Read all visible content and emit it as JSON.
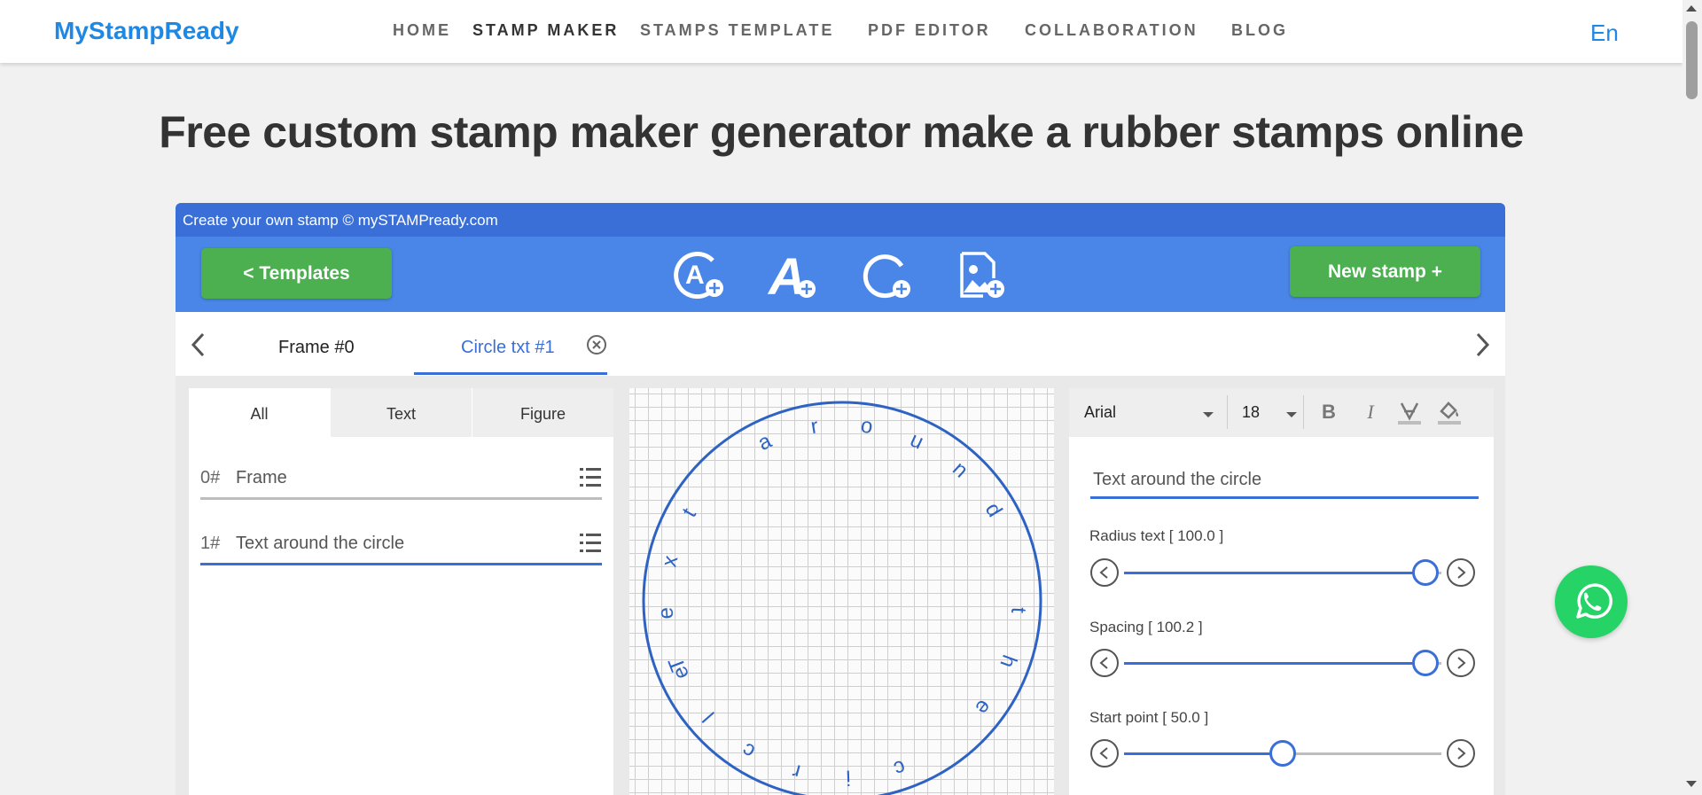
{
  "nav": {
    "brand": "MyStampReady",
    "links": [
      "HOME",
      "STAMP MAKER",
      "STAMPS TEMPLATE",
      "PDF EDITOR",
      "COLLABORATION",
      "BLOG"
    ],
    "active_link": "STAMP MAKER",
    "lang": "En"
  },
  "page_title": "Free custom stamp maker generator make a rubber stamps online",
  "editor": {
    "header": "Create your own stamp © mySTAMPready.com",
    "templates_button": "<  Templates",
    "new_stamp_button": "New stamp +",
    "tool_icons": [
      "circle-text-add-icon",
      "text-add-icon",
      "circle-add-icon",
      "image-add-icon"
    ],
    "tabs": [
      {
        "label": "Frame #0",
        "active": false
      },
      {
        "label": "Circle txt #1",
        "active": true
      }
    ],
    "subtabs": [
      "All",
      "Text",
      "Figure"
    ],
    "layers": [
      {
        "index": "0#",
        "label": "Frame",
        "active": false
      },
      {
        "index": "1#",
        "label": "Text around the circle",
        "active": true
      }
    ],
    "canvas": {
      "circle_text": "Text around the circle",
      "stroke_color": "#2e63c4"
    },
    "format": {
      "font": "Arial",
      "size": "18"
    },
    "text_value": "Text around the circle",
    "sliders": [
      {
        "label": "Radius text [ 100.0 ]",
        "fraction": 0.95
      },
      {
        "label": "Spacing [ 100.2 ]",
        "fraction": 0.95
      },
      {
        "label": "Start point [ 50.0 ]",
        "fraction": 0.5
      }
    ]
  },
  "colors": {
    "accent": "#3a6fd8",
    "toolbar": "#4a86e8",
    "green": "#4caf50",
    "whatsapp": "#25d366",
    "brand": "#1e88e5"
  }
}
